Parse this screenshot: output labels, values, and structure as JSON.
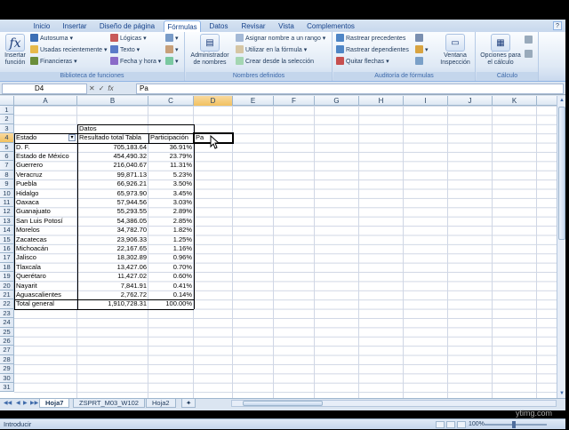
{
  "tabs": [
    "Inicio",
    "Insertar",
    "Diseño de página",
    "Fórmulas",
    "Datos",
    "Revisar",
    "Vista",
    "Complementos"
  ],
  "active_tab": "Fórmulas",
  "ribbon": {
    "insert_function": "Insertar función",
    "autosuma": "Autosuma",
    "usadas": "Usadas recientemente",
    "financieras": "Financieras",
    "logicas": "Lógicas",
    "texto": "Texto",
    "fecha": "Fecha y hora",
    "group_biblioteca": "Biblioteca de funciones",
    "admin_nombres": "Administrador de nombres",
    "asignar_nombre": "Asignar nombre a un rango",
    "utilizar_formula": "Utilizar en la fórmula",
    "crear_seleccion": "Crear desde la selección",
    "group_nombres": "Nombres definidos",
    "rastrear_prec": "Rastrear precedentes",
    "rastrear_dep": "Rastrear dependientes",
    "quitar_flechas": "Quitar flechas",
    "ventana_inspeccion": "Ventana Inspección",
    "group_auditoria": "Auditoría de fórmulas",
    "opciones_calculo": "Opciones para el cálculo",
    "group_calculo": "Cálculo"
  },
  "formula_bar": {
    "name_box": "D4",
    "fx": "fx",
    "content": "Pa"
  },
  "columns": [
    "A",
    "B",
    "C",
    "D",
    "E",
    "F",
    "G",
    "H",
    "I",
    "J",
    "K"
  ],
  "rows": [
    "1",
    "2",
    "3",
    "4",
    "5",
    "6",
    "7",
    "8",
    "9",
    "10",
    "11",
    "12",
    "13",
    "14",
    "15",
    "16",
    "17",
    "18",
    "19",
    "20",
    "21",
    "22",
    "23",
    "24",
    "25",
    "26",
    "27",
    "28",
    "29",
    "30",
    "31"
  ],
  "pivot": {
    "datos_label": "Datos",
    "header": [
      "Estado",
      "Resultado total Tabla",
      "Participación",
      "Pa"
    ],
    "rows": [
      [
        "D. F.",
        "705,183.64",
        "36.91%"
      ],
      [
        "Estado de México",
        "454,490.32",
        "23.79%"
      ],
      [
        "Guerrero",
        "216,040.67",
        "11.31%"
      ],
      [
        "Veracruz",
        "99,871.13",
        "5.23%"
      ],
      [
        "Puebla",
        "66,926.21",
        "3.50%"
      ],
      [
        "Hidalgo",
        "65,973.90",
        "3.45%"
      ],
      [
        "Oaxaca",
        "57,944.56",
        "3.03%"
      ],
      [
        "Guanajuato",
        "55,293.55",
        "2.89%"
      ],
      [
        "San Luis Potosí",
        "54,386.05",
        "2.85%"
      ],
      [
        "Morelos",
        "34,782.70",
        "1.82%"
      ],
      [
        "Zacatecas",
        "23,906.33",
        "1.25%"
      ],
      [
        "Michoacán",
        "22,167.65",
        "1.16%"
      ],
      [
        "Jalisco",
        "18,302.89",
        "0.96%"
      ],
      [
        "Tlaxcala",
        "13,427.06",
        "0.70%"
      ],
      [
        "Querétaro",
        "11,427.02",
        "0.60%"
      ],
      [
        "Nayarit",
        "7,841.91",
        "0.41%"
      ],
      [
        "Aguascalientes",
        "2,762.72",
        "0.14%"
      ]
    ],
    "total": [
      "Total general",
      "1,910,728.31",
      "100.00%"
    ]
  },
  "sheets": [
    "Hoja7",
    "ZSPRT_M03_W102",
    "Hoja2"
  ],
  "active_sheet": "Hoja7",
  "status": {
    "mode": "Introducir",
    "zoom": "100%"
  },
  "watermark": "ytimg.com"
}
